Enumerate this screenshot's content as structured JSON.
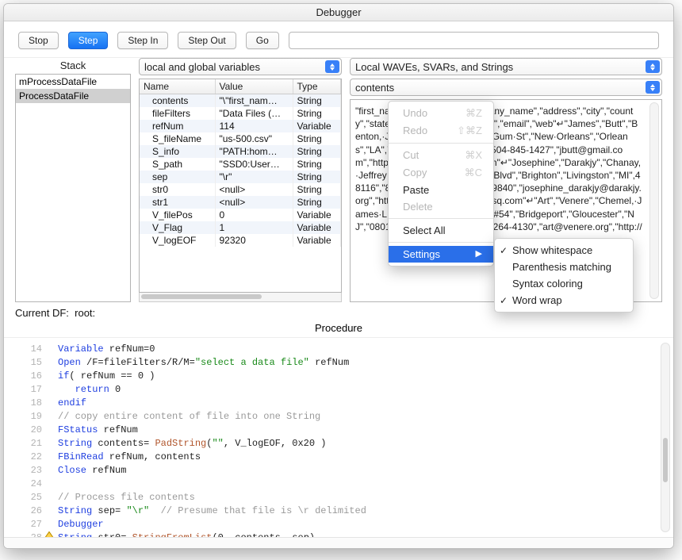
{
  "window": {
    "title": "Debugger"
  },
  "toolbar": {
    "stop": "Stop",
    "step": "Step",
    "step_in": "Step In",
    "step_out": "Step Out",
    "go": "Go",
    "go_value": ""
  },
  "stack": {
    "title": "Stack",
    "items": [
      "mProcessDataFile",
      "ProcessDataFile"
    ],
    "selected_index": 1
  },
  "vars": {
    "selector": "local and global variables",
    "headers": {
      "name": "Name",
      "value": "Value",
      "type": "Type"
    },
    "rows": [
      {
        "name": "contents",
        "value": "\"\\\"first_nam…",
        "type": "String"
      },
      {
        "name": "fileFilters",
        "value": "\"Data Files (…",
        "type": "String"
      },
      {
        "name": "refNum",
        "value": "114",
        "type": "Variable"
      },
      {
        "name": "S_fileName",
        "value": "\"us-500.csv\"",
        "type": "String"
      },
      {
        "name": "S_info",
        "value": "\"PATH:hom…",
        "type": "String"
      },
      {
        "name": "S_path",
        "value": "\"SSD0:User…",
        "type": "String"
      },
      {
        "name": "sep",
        "value": "\"\\r\"",
        "type": "String"
      },
      {
        "name": "str0",
        "value": "<null>",
        "type": "String"
      },
      {
        "name": "str1",
        "value": "<null>",
        "type": "String"
      },
      {
        "name": "V_filePos",
        "value": "0",
        "type": "Variable"
      },
      {
        "name": "V_Flag",
        "value": "1",
        "type": "Variable"
      },
      {
        "name": "V_logEOF",
        "value": "92320",
        "type": "Variable"
      }
    ]
  },
  "right": {
    "selector1": "Local WAVEs, SVARs, and Strings",
    "selector2": "contents",
    "content_lines": [
      "\"first_name\",\"last_name\",\"company_name\",\"address\",\"city\",\"county\",\"state\",\"zip\",\"phone1\",\"phone2\",\"email\",\"web\"↵",
      "\"James\",\"Butt\",\"Benton,·John·B·Jr\",\"6649·N·Blue·Gum·St\",\"New·Orleans\",\"Orleans\",\"LA\",70116\",\"504-621-8927\",\"504-845-1427\",\"jbutt@gmail.com\",\"http://www.bentonjohnbjr.com\"↵",
      "\"Josephine\",\"Darakjy\",\"Chanay,·Jeffrey·A·Esq\",\"4·B·Blue·Ridge·Blvd\",\"Brighton\",\"Livingston\",\"MI\",48116\",\"810-292-9388\",\"810-374-9840\",\"josephine_darakjy@darakjy.org\",\"http://www.chanayjeffreyaesq.com\"↵",
      "\"Art\",\"Venere\",\"Chemel,·James·L·Cpa\",\"8·W·Cerritos·Ave·#54\",\"Bridgeport\",\"Gloucester\",\"NJ\",\"08014\",\"856-636-8749\",\"856-264-4130\",\"art@venere.org\",\"http://"
    ]
  },
  "context_menu": {
    "items": [
      {
        "label": "Undo",
        "shortcut": "⌘Z",
        "disabled": true
      },
      {
        "label": "Redo",
        "shortcut": "⇧⌘Z",
        "disabled": true
      },
      {
        "sep": true
      },
      {
        "label": "Cut",
        "shortcut": "⌘X",
        "disabled": true
      },
      {
        "label": "Copy",
        "shortcut": "⌘C",
        "disabled": true
      },
      {
        "label": "Paste",
        "shortcut": "",
        "disabled": false
      },
      {
        "label": "Delete",
        "shortcut": "",
        "disabled": true
      },
      {
        "sep": true
      },
      {
        "label": "Select All",
        "shortcut": "",
        "disabled": false
      },
      {
        "sep": true
      },
      {
        "label": "Settings",
        "shortcut": "",
        "disabled": false,
        "selected": true,
        "submenu": true
      }
    ],
    "submenu": [
      {
        "label": "Show whitespace",
        "checked": true
      },
      {
        "label": "Parenthesis matching",
        "checked": false
      },
      {
        "label": "Syntax coloring",
        "checked": false
      },
      {
        "label": "Word wrap",
        "checked": true
      }
    ]
  },
  "current_df": {
    "label": "Current DF:",
    "value": "root:"
  },
  "procedure": {
    "title": "Procedure",
    "first_line": 14,
    "current_line": 28,
    "lines": [
      {
        "n": 14,
        "html": "<span class='kw'>Variable</span> refNum=0"
      },
      {
        "n": 15,
        "html": "<span class='kw'>Open</span> /F=fileFilters/R/M=<span class='str'>\"select a data file\"</span> refNum"
      },
      {
        "n": 16,
        "html": "<span class='kw'>if</span>( refNum == 0 )"
      },
      {
        "n": 17,
        "html": "   <span class='kw'>return</span> 0"
      },
      {
        "n": 18,
        "html": "<span class='kw'>endif</span>"
      },
      {
        "n": 19,
        "html": "<span class='cm'>// copy entire content of file into one String</span>"
      },
      {
        "n": 20,
        "html": "<span class='kw'>FStatus</span> refNum"
      },
      {
        "n": 21,
        "html": "<span class='kw'>String</span> contents= <span class='fn'>PadString</span>(<span class='str'>\"\"</span>, V_logEOF, 0x20 )"
      },
      {
        "n": 22,
        "html": "<span class='kw'>FBinRead</span> refNum, contents"
      },
      {
        "n": 23,
        "html": "<span class='kw'>Close</span> refNum"
      },
      {
        "n": 24,
        "html": ""
      },
      {
        "n": 25,
        "html": "<span class='cm'>// Process file contents</span>"
      },
      {
        "n": 26,
        "html": "<span class='kw'>String</span> sep= <span class='str'>\"\\r\"</span>  <span class='cm'>// Presume that file is \\r delimited</span>"
      },
      {
        "n": 27,
        "html": "<span class='kw'>Debugger</span>"
      },
      {
        "n": 28,
        "html": "<span class='kw'>String</span> str0= <span class='fn'>StringFromList</span>(0, contents, sep)"
      }
    ]
  }
}
